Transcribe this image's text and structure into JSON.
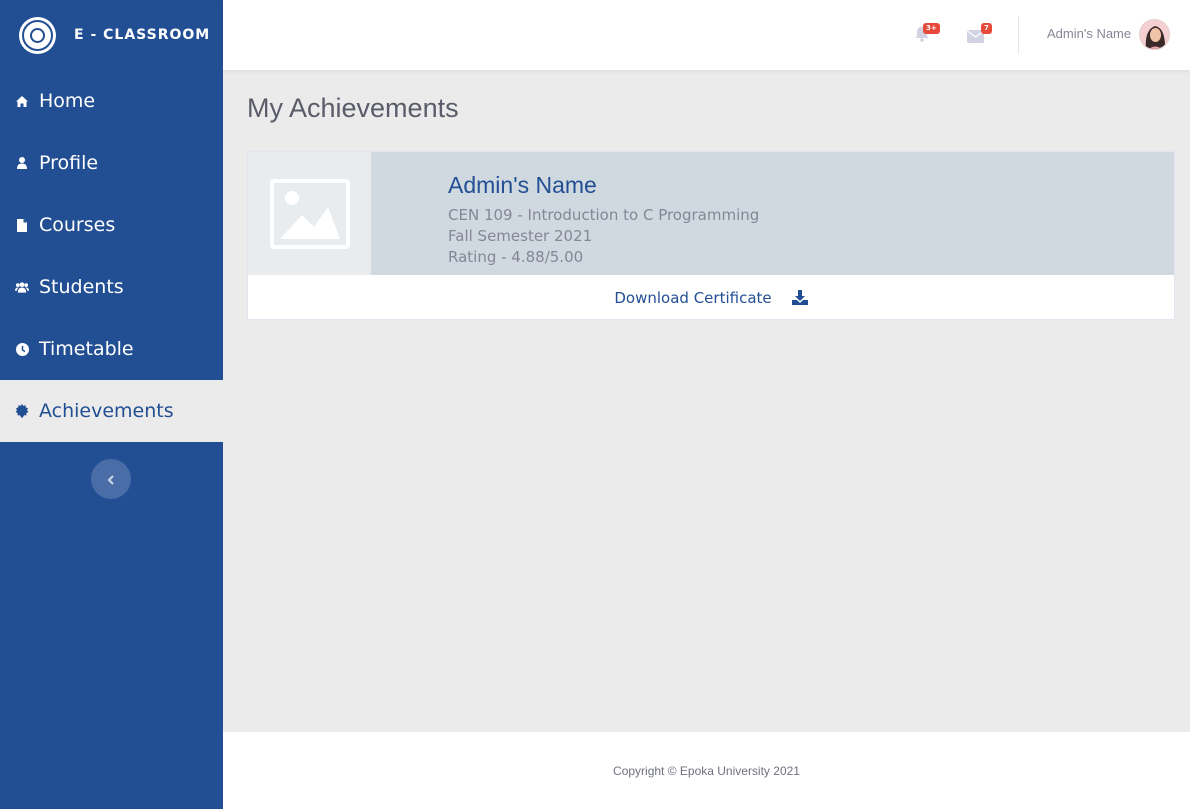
{
  "brand": {
    "name": "E - CLASSROOM",
    "logo_icon": "university-seal-icon"
  },
  "sidebar": {
    "items": [
      {
        "label": "Home",
        "icon": "home-icon"
      },
      {
        "label": "Profile",
        "icon": "user-icon"
      },
      {
        "label": "Courses",
        "icon": "file-icon"
      },
      {
        "label": "Students",
        "icon": "users-icon"
      },
      {
        "label": "Timetable",
        "icon": "clock-icon"
      },
      {
        "label": "Achievements",
        "icon": "certificate-icon",
        "active": true
      }
    ],
    "collapse_icon": "chevron-left-icon"
  },
  "topbar": {
    "notifications_badge": "3+",
    "messages_badge": "7",
    "user_name": "Admin's Name"
  },
  "page": {
    "title": "My Achievements"
  },
  "achievement": {
    "name": "Admin's Name",
    "course": "CEN 109 - Introduction to C Programming",
    "semester": "Fall Semester 2021",
    "rating": "Rating - 4.88/5.00",
    "download_label": "Download Certificate"
  },
  "footer": {
    "copyright": "Copyright © Epoka University 2021"
  },
  "colors": {
    "primary": "#224f93",
    "badge": "#e74a3b",
    "background": "#ebebeb"
  }
}
